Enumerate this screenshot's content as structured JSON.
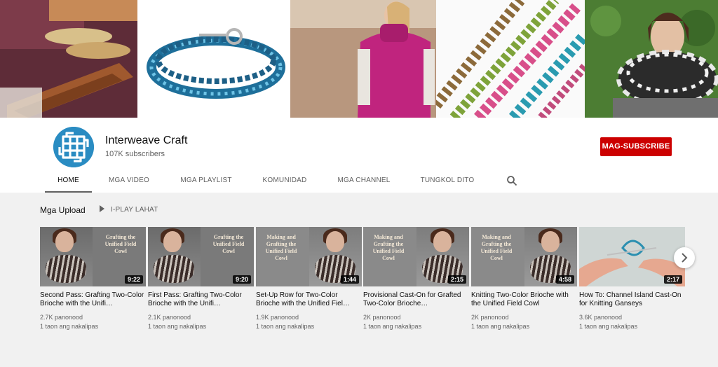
{
  "channel": {
    "name": "Interweave Craft",
    "subscribers": "107K subscribers",
    "subscribe_label": "MAG-SUBSCRIBE",
    "accent": "#cc0000",
    "avatar_color": "#2a8cc2"
  },
  "tabs": [
    {
      "label": "HOME",
      "active": true
    },
    {
      "label": "MGA VIDEO"
    },
    {
      "label": "MGA PLAYLIST"
    },
    {
      "label": "KOMUNIDAD"
    },
    {
      "label": "MGA CHANNEL"
    },
    {
      "label": "TUNGKOL DITO"
    }
  ],
  "icons": {
    "search": "search-icon",
    "next": "chevron-right-icon",
    "play": "play-icon"
  },
  "uploads": {
    "title": "Mga Upload",
    "play_all": "I-PLAY LAHAT",
    "videos": [
      {
        "title": "Second Pass: Grafting Two-Color Brioche with the Unifi…",
        "views": "2.7K panonood",
        "age": "1 taon ang nakalipas",
        "duration": "9:22",
        "thumb_text": "Grafting the Unified Field Cowl"
      },
      {
        "title": "First Pass: Grafting Two-Color Brioche with the Unifi…",
        "views": "2.1K panonood",
        "age": "1 taon ang nakalipas",
        "duration": "9:20",
        "thumb_text": "Grafting the Unified Field Cowl"
      },
      {
        "title": "Set-Up Row for Two-Color Brioche with the Unified Fiel…",
        "views": "1.9K panonood",
        "age": "1 taon ang nakalipas",
        "duration": "1:44",
        "thumb_text": "Making and Grafting the Unified Field Cowl"
      },
      {
        "title": "Provisional Cast-On for Grafted Two-Color Brioche…",
        "views": "2K panonood",
        "age": "1 taon ang nakalipas",
        "duration": "2:15",
        "thumb_text": "Making and Grafting the Unified Field Cowl"
      },
      {
        "title": "Knitting Two-Color Brioche with the Unified Field Cowl",
        "views": "2K panonood",
        "age": "1 taon ang nakalipas",
        "duration": "4:58",
        "thumb_text": "Making and Grafting the Unified Field Cowl"
      },
      {
        "title": "How To: Channel Island Cast-On for Knitting Ganseys",
        "views": "3.6K panonood",
        "age": "1 taon ang nakalipas",
        "duration": "2:17",
        "thumb_text": ""
      }
    ]
  }
}
